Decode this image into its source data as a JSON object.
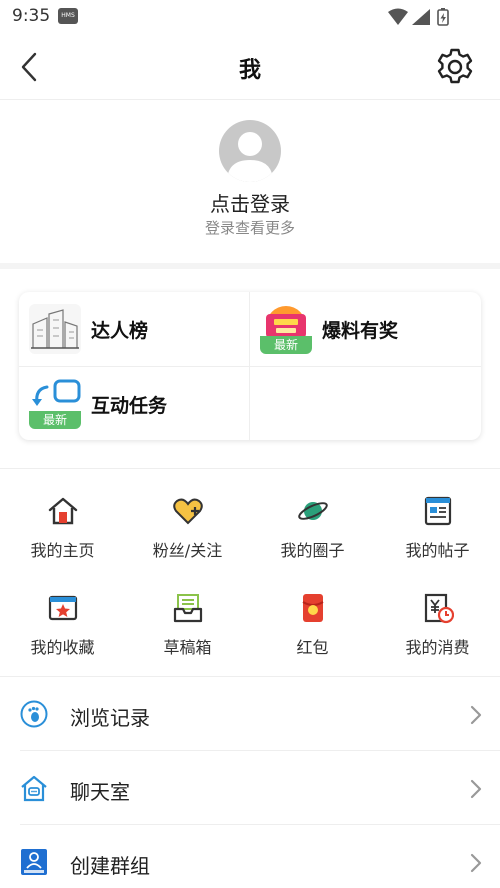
{
  "status_bar": {
    "time": "9:35",
    "hms_badge": "HMS"
  },
  "header": {
    "title": "我"
  },
  "profile": {
    "login_text": "点击登录",
    "login_sub": "登录查看更多"
  },
  "features": [
    {
      "label": "达人榜",
      "icon": "ranking-sketch-icon",
      "badge": ""
    },
    {
      "label": "爆料有奖",
      "icon": "report-reward-icon",
      "badge": "最新"
    },
    {
      "label": "互动任务",
      "icon": "interactive-task-icon",
      "badge": "最新"
    }
  ],
  "grid": [
    {
      "label": "我的主页",
      "icon": "home-icon"
    },
    {
      "label": "粉丝/关注",
      "icon": "heart-plus-icon"
    },
    {
      "label": "我的圈子",
      "icon": "planet-icon"
    },
    {
      "label": "我的帖子",
      "icon": "post-doc-icon"
    },
    {
      "label": "我的收藏",
      "icon": "star-window-icon"
    },
    {
      "label": "草稿箱",
      "icon": "draft-inbox-icon"
    },
    {
      "label": "红包",
      "icon": "red-packet-icon"
    },
    {
      "label": "我的消费",
      "icon": "spending-clock-icon"
    }
  ],
  "list": [
    {
      "label": "浏览记录",
      "icon": "footprint-icon"
    },
    {
      "label": "聊天室",
      "icon": "chat-house-icon"
    },
    {
      "label": "创建群组",
      "icon": "create-group-icon"
    }
  ],
  "colors": {
    "accent_blue": "#2a8fd8",
    "badge_green": "#5bbf6a",
    "red": "#e5402f"
  }
}
